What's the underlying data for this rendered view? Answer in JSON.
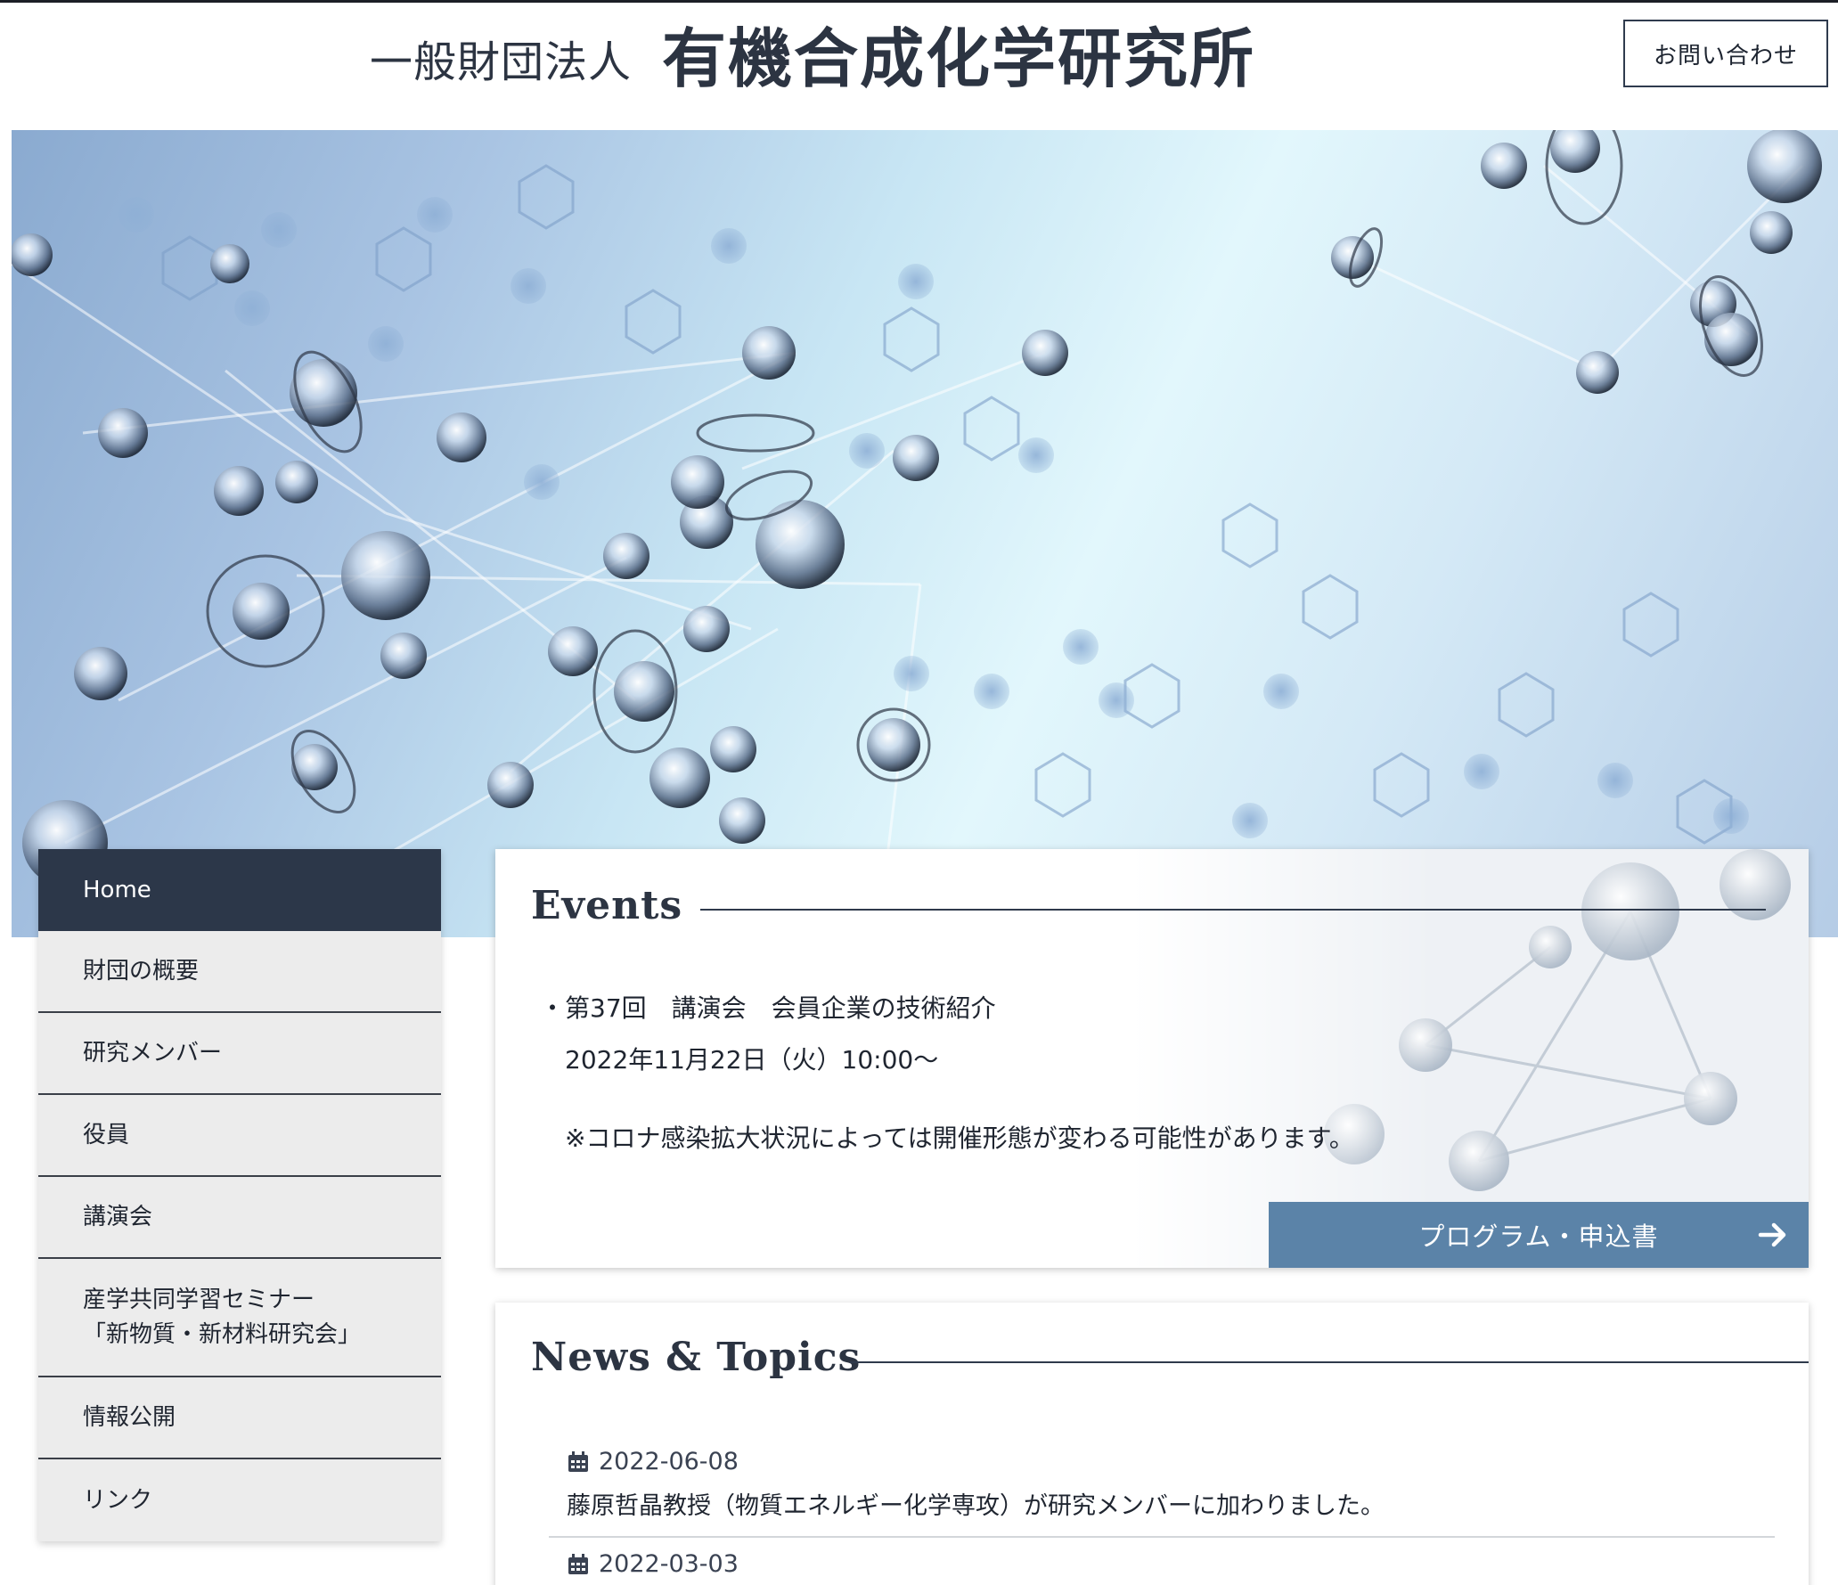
{
  "header": {
    "title_prefix": "一般財団法人",
    "title_name": "有機合成化学研究所",
    "contact_label": "お問い合わせ"
  },
  "colors": {
    "nav_active": "#2c3749",
    "accent_button": "#5b83a8",
    "title_text": "#2c3442"
  },
  "sidebar": {
    "items": [
      {
        "label": "Home",
        "active": true
      },
      {
        "label": "財団の概要"
      },
      {
        "label": "研究メンバー"
      },
      {
        "label": "役員"
      },
      {
        "label": "講演会"
      },
      {
        "label_line1": "産学共同学習セミナー",
        "label_line2": "「新物質・新材料研究会」"
      },
      {
        "label": "情報公開"
      },
      {
        "label": "リンク"
      }
    ]
  },
  "events": {
    "title": "Events",
    "item_title": "・第37回　講演会　会員企業の技術紹介",
    "item_date": "2022年11月22日（火）10:00～",
    "note": "※コロナ感染拡大状況によっては開催形態が変わる可能性があります。",
    "button_label": "プログラム・申込書",
    "button_icon": "arrow-right-icon"
  },
  "news": {
    "title": "News & Topics",
    "items": [
      {
        "date": "2022-06-08",
        "text": "藤原哲晶教授（物質エネルギー化学専攻）が研究メンバーに加わりました。",
        "icon": "calendar-icon"
      },
      {
        "date": "2022-03-03",
        "icon": "calendar-icon"
      }
    ]
  }
}
